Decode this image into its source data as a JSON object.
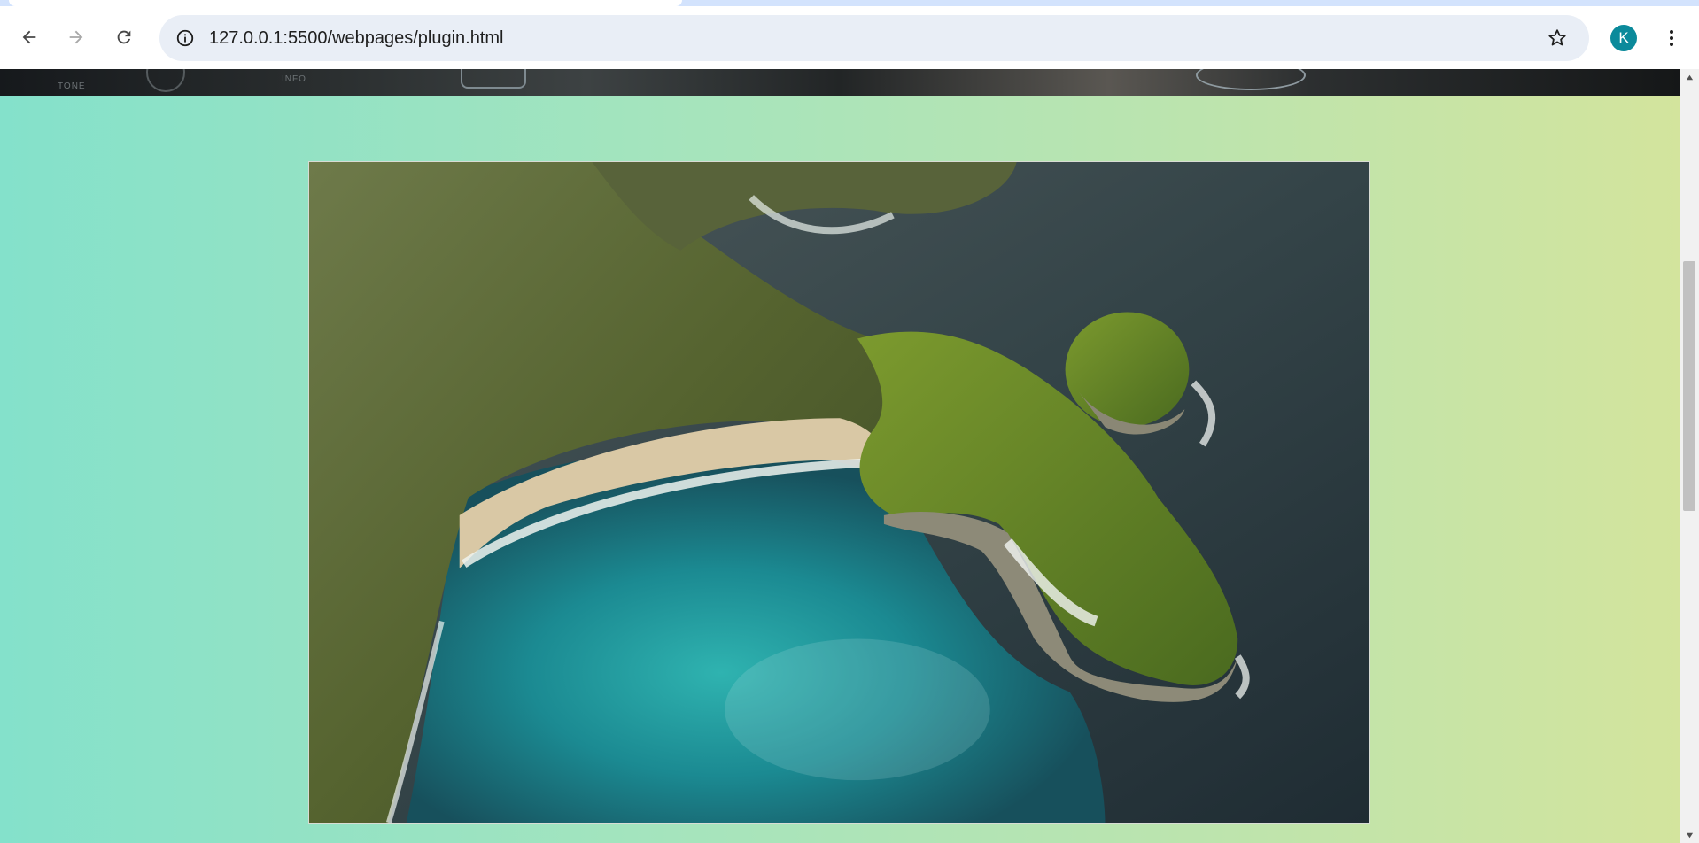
{
  "browser": {
    "address_bar": {
      "url": "127.0.0.1:5500/webpages/plugin.html"
    },
    "profile": {
      "initial": "K",
      "color": "#0b8a9b"
    },
    "icons": [
      "back-arrow-icon",
      "forward-arrow-icon",
      "reload-icon",
      "site-info-icon",
      "bookmark-star-icon",
      "more-menu-icon"
    ]
  },
  "page": {
    "background_gradient": [
      "#84e1cb",
      "#d3e49d"
    ],
    "top_strip": {
      "labels": [
        "TONE",
        "INFO"
      ]
    }
  }
}
